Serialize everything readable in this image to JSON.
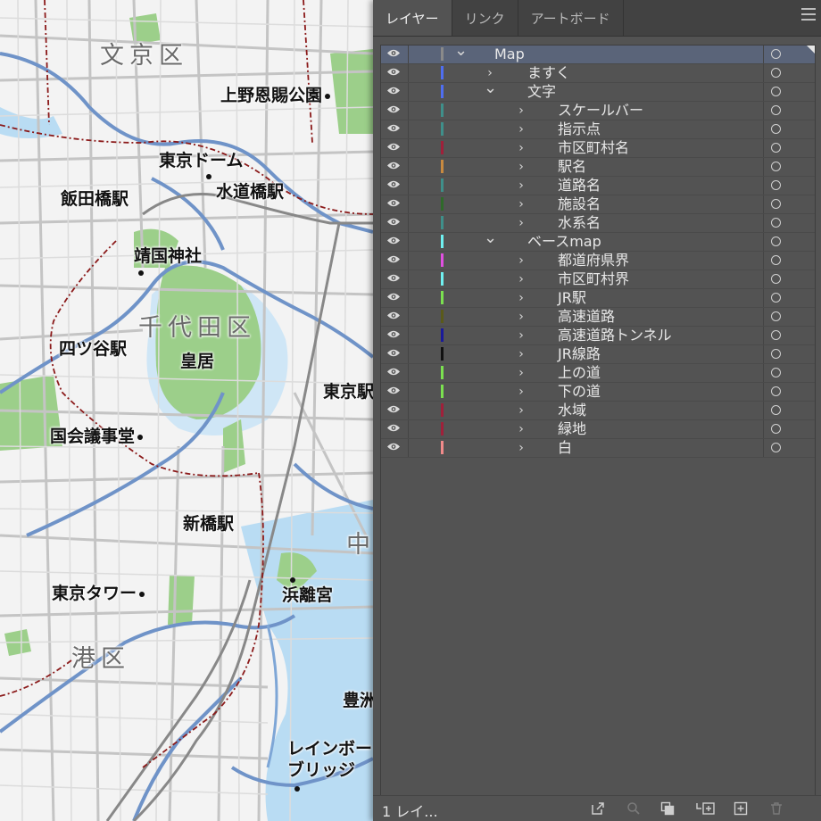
{
  "map": {
    "wards": {
      "bunkyo": "文京区",
      "chiyoda": "千代田区",
      "minato": "港区",
      "chuo": "中"
    },
    "places": {
      "ueno": "上野恩賜公園",
      "tokyo_dome": "東京ドーム",
      "iidabashi": "飯田橋駅",
      "suidobashi": "水道橋駅",
      "yasukuni": "靖国神社",
      "yotsuya": "四ツ谷駅",
      "kokyo": "皇居",
      "tokyo_eki": "東京駅",
      "kokkai": "国会議事堂",
      "shimbashi": "新橋駅",
      "tokyo_tower": "東京タワー",
      "hamarikyu": "浜離宮",
      "toyosu": "豊洲",
      "rainbow_1": "レインボー",
      "rainbow_2": "ブリッジ"
    }
  },
  "panel": {
    "tabs": [
      "レイヤー",
      "リンク",
      "アートボード"
    ],
    "footer_count": "1 レイ...",
    "layers": [
      {
        "name": "Map",
        "level": 0,
        "expanded": true,
        "color": "#8a8a8a",
        "selected": true
      },
      {
        "name": "ますく",
        "level": 1,
        "expanded": false,
        "color": "#4f6ef0"
      },
      {
        "name": "文字",
        "level": 1,
        "expanded": true,
        "color": "#4f6ef0"
      },
      {
        "name": "スケールバー",
        "level": 2,
        "expanded": false,
        "color": "#3f8f8a"
      },
      {
        "name": "指示点",
        "level": 2,
        "expanded": false,
        "color": "#3f8f8a"
      },
      {
        "name": "市区町村名",
        "level": 2,
        "expanded": false,
        "color": "#a0203a"
      },
      {
        "name": "駅名",
        "level": 2,
        "expanded": false,
        "color": "#c88a40"
      },
      {
        "name": "道路名",
        "level": 2,
        "expanded": false,
        "color": "#3f8f8a"
      },
      {
        "name": "施設名",
        "level": 2,
        "expanded": false,
        "color": "#2f6a2a"
      },
      {
        "name": "水系名",
        "level": 2,
        "expanded": false,
        "color": "#3f8f8a"
      },
      {
        "name": "ベースmap",
        "level": 1,
        "expanded": true,
        "color": "#6ff0f0"
      },
      {
        "name": "都道府県界",
        "level": 2,
        "expanded": false,
        "color": "#e050e0"
      },
      {
        "name": "市区町村界",
        "level": 2,
        "expanded": false,
        "color": "#6ff0f0"
      },
      {
        "name": "JR駅",
        "level": 2,
        "expanded": false,
        "color": "#7be050"
      },
      {
        "name": "高速道路",
        "level": 2,
        "expanded": false,
        "color": "#5a5a1a"
      },
      {
        "name": "高速道路トンネル",
        "level": 2,
        "expanded": false,
        "color": "#1a1a9a"
      },
      {
        "name": "JR線路",
        "level": 2,
        "expanded": false,
        "color": "#111111"
      },
      {
        "name": "上の道",
        "level": 2,
        "expanded": false,
        "color": "#7be050"
      },
      {
        "name": "下の道",
        "level": 2,
        "expanded": false,
        "color": "#7be050"
      },
      {
        "name": "水域",
        "level": 2,
        "expanded": false,
        "color": "#a0203a"
      },
      {
        "name": "緑地",
        "level": 2,
        "expanded": false,
        "color": "#a0203a"
      },
      {
        "name": "白",
        "level": 2,
        "expanded": false,
        "color": "#f08a8a"
      }
    ]
  },
  "colors": {
    "panel_bg": "#535353",
    "tab_bar": "#424242",
    "selected_row": "#5a6479",
    "water": "#b9dcf3",
    "green": "#9ccf8a",
    "road_main": "#6f93c8",
    "boundary": "#8b1a1a"
  }
}
